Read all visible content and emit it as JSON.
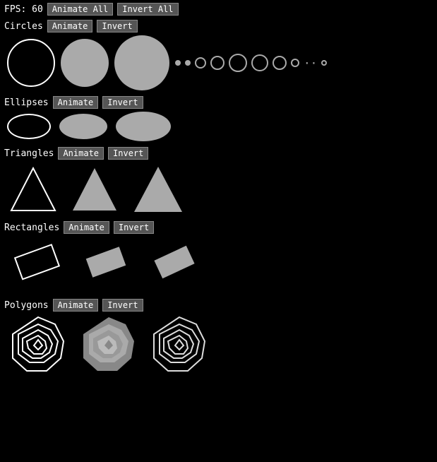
{
  "topbar": {
    "fps_label": "FPS: 60",
    "animate_all_label": "Animate All",
    "invert_all_label": "Invert All"
  },
  "sections": {
    "circles": {
      "label": "Circles",
      "animate_label": "Animate",
      "invert_label": "Invert"
    },
    "ellipses": {
      "label": "Ellipses",
      "animate_label": "Animate",
      "invert_label": "Invert"
    },
    "triangles": {
      "label": "Triangles",
      "animate_label": "Animate",
      "invert_label": "Invert"
    },
    "rectangles": {
      "label": "Rectangles",
      "animate_label": "Animate",
      "invert_label": "Invert"
    },
    "polygons": {
      "label": "Polygons",
      "animate_label": "Animate",
      "invert_label": "Invert"
    }
  }
}
